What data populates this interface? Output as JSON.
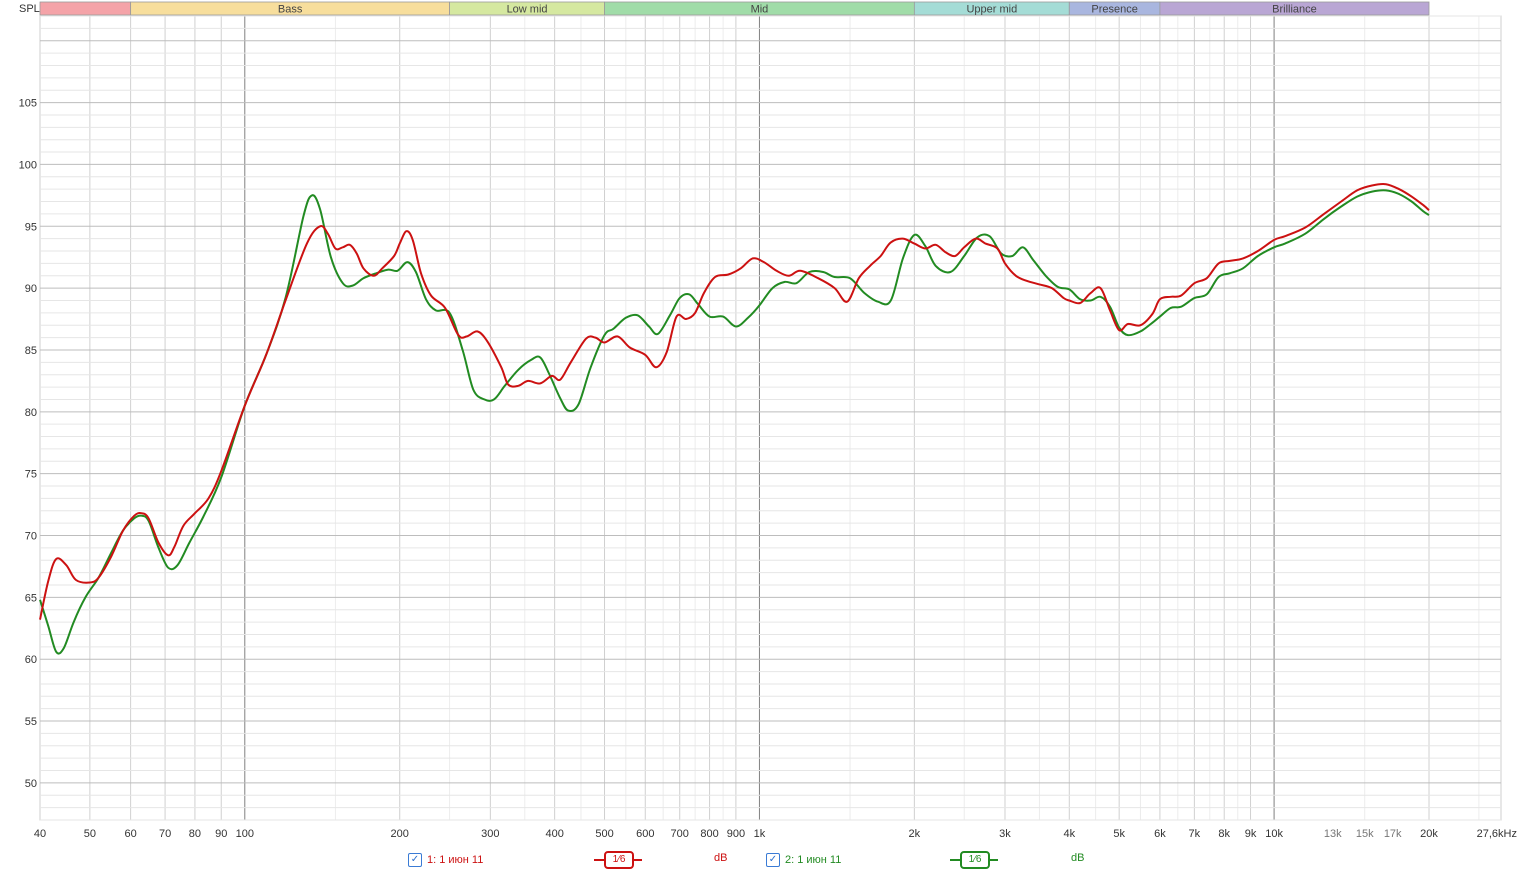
{
  "y_axis_label": "SPL",
  "bands": [
    {
      "label": "",
      "from": 40,
      "to": 60,
      "color": "#f4a3a8"
    },
    {
      "label": "Bass",
      "from": 60,
      "to": 250,
      "color": "#f7de9c"
    },
    {
      "label": "Low mid",
      "from": 250,
      "to": 500,
      "color": "#d5e8a0"
    },
    {
      "label": "Mid",
      "from": 500,
      "to": 2000,
      "color": "#a0dca8"
    },
    {
      "label": "Upper mid",
      "from": 2000,
      "to": 4000,
      "color": "#a4dcd6"
    },
    {
      "label": "Presence",
      "from": 4000,
      "to": 6000,
      "color": "#a9b6df"
    },
    {
      "label": "Brilliance",
      "from": 6000,
      "to": 20000,
      "color": "#b9a6d4"
    }
  ],
  "legend": [
    {
      "checked": "✓",
      "label": "1: 1 июн 11",
      "smoothing": "1⁄6",
      "unit": "dB",
      "color": "#cc1111"
    },
    {
      "checked": "✓",
      "label": "2: 1 июн 11",
      "smoothing": "1⁄6",
      "unit": "dB",
      "color": "#228b22"
    }
  ],
  "chart_data": {
    "type": "line",
    "xscale": "log",
    "xlim": [
      40,
      27600
    ],
    "ylim": [
      47,
      112
    ],
    "grid": true,
    "x_ticks": [
      {
        "value": 40,
        "label": "40"
      },
      {
        "value": 50,
        "label": "50"
      },
      {
        "value": 60,
        "label": "60"
      },
      {
        "value": 70,
        "label": "70"
      },
      {
        "value": 80,
        "label": "80"
      },
      {
        "value": 90,
        "label": "90"
      },
      {
        "value": 100,
        "label": "100"
      },
      {
        "value": 200,
        "label": "200"
      },
      {
        "value": 300,
        "label": "300"
      },
      {
        "value": 400,
        "label": "400"
      },
      {
        "value": 500,
        "label": "500"
      },
      {
        "value": 600,
        "label": "600"
      },
      {
        "value": 700,
        "label": "700"
      },
      {
        "value": 800,
        "label": "800"
      },
      {
        "value": 900,
        "label": "900"
      },
      {
        "value": 1000,
        "label": "1k"
      },
      {
        "value": 2000,
        "label": "2k"
      },
      {
        "value": 3000,
        "label": "3k"
      },
      {
        "value": 4000,
        "label": "4k"
      },
      {
        "value": 5000,
        "label": "5k"
      },
      {
        "value": 6000,
        "label": "6k"
      },
      {
        "value": 7000,
        "label": "7k"
      },
      {
        "value": 8000,
        "label": "8k"
      },
      {
        "value": 9000,
        "label": "9k"
      },
      {
        "value": 10000,
        "label": "10k"
      },
      {
        "value": 13000,
        "label": "13k",
        "light": true
      },
      {
        "value": 15000,
        "label": "15k",
        "light": true
      },
      {
        "value": 17000,
        "label": "17k",
        "light": true
      },
      {
        "value": 20000,
        "label": "20k"
      },
      {
        "value": 27600,
        "label": "27,6kHz"
      }
    ],
    "y_ticks": [
      50,
      55,
      60,
      65,
      70,
      75,
      80,
      85,
      90,
      95,
      100,
      105
    ],
    "series": [
      {
        "name": "1: 1 июн 11",
        "color": "#cc1111",
        "points": [
          [
            40,
            63.2
          ],
          [
            41.5,
            66.3
          ],
          [
            43,
            68.1
          ],
          [
            45,
            67.6
          ],
          [
            47,
            66.4
          ],
          [
            50,
            66.2
          ],
          [
            52,
            66.6
          ],
          [
            55,
            68.3
          ],
          [
            58,
            70.4
          ],
          [
            61,
            71.6
          ],
          [
            63,
            71.8
          ],
          [
            65,
            71.4
          ],
          [
            68,
            69.4
          ],
          [
            71,
            68.4
          ],
          [
            73,
            69.1
          ],
          [
            76,
            70.8
          ],
          [
            80,
            71.8
          ],
          [
            85,
            73.0
          ],
          [
            90,
            75.2
          ],
          [
            100,
            80.5
          ],
          [
            110,
            84.6
          ],
          [
            120,
            89.0
          ],
          [
            132,
            93.6
          ],
          [
            140,
            95.0
          ],
          [
            145,
            94.4
          ],
          [
            150,
            93.2
          ],
          [
            155,
            93.3
          ],
          [
            160,
            93.5
          ],
          [
            165,
            92.8
          ],
          [
            170,
            91.6
          ],
          [
            178,
            91.0
          ],
          [
            185,
            91.6
          ],
          [
            195,
            92.6
          ],
          [
            200,
            93.6
          ],
          [
            206,
            94.6
          ],
          [
            212,
            93.9
          ],
          [
            220,
            91.2
          ],
          [
            230,
            89.4
          ],
          [
            245,
            88.4
          ],
          [
            260,
            86.2
          ],
          [
            270,
            86.1
          ],
          [
            283,
            86.5
          ],
          [
            296,
            85.7
          ],
          [
            315,
            83.6
          ],
          [
            325,
            82.2
          ],
          [
            340,
            82.1
          ],
          [
            355,
            82.5
          ],
          [
            375,
            82.3
          ],
          [
            395,
            82.9
          ],
          [
            410,
            82.6
          ],
          [
            430,
            84.0
          ],
          [
            460,
            85.9
          ],
          [
            480,
            86.0
          ],
          [
            500,
            85.6
          ],
          [
            530,
            86.1
          ],
          [
            560,
            85.2
          ],
          [
            600,
            84.6
          ],
          [
            630,
            83.6
          ],
          [
            660,
            84.8
          ],
          [
            690,
            87.7
          ],
          [
            720,
            87.5
          ],
          [
            750,
            88.0
          ],
          [
            780,
            89.6
          ],
          [
            820,
            90.9
          ],
          [
            870,
            91.1
          ],
          [
            920,
            91.6
          ],
          [
            970,
            92.4
          ],
          [
            1020,
            92.1
          ],
          [
            1080,
            91.4
          ],
          [
            1140,
            91.0
          ],
          [
            1200,
            91.4
          ],
          [
            1300,
            90.8
          ],
          [
            1400,
            90.0
          ],
          [
            1480,
            88.9
          ],
          [
            1560,
            90.8
          ],
          [
            1640,
            91.8
          ],
          [
            1720,
            92.6
          ],
          [
            1800,
            93.7
          ],
          [
            1900,
            94.0
          ],
          [
            2000,
            93.6
          ],
          [
            2100,
            93.2
          ],
          [
            2200,
            93.5
          ],
          [
            2300,
            92.9
          ],
          [
            2400,
            92.6
          ],
          [
            2500,
            93.3
          ],
          [
            2630,
            94.0
          ],
          [
            2750,
            93.6
          ],
          [
            2900,
            93.2
          ],
          [
            3000,
            92.0
          ],
          [
            3150,
            91.0
          ],
          [
            3300,
            90.6
          ],
          [
            3500,
            90.3
          ],
          [
            3700,
            90.0
          ],
          [
            3900,
            89.2
          ],
          [
            4000,
            89.0
          ],
          [
            4200,
            88.8
          ],
          [
            4400,
            89.6
          ],
          [
            4600,
            90.0
          ],
          [
            4800,
            88.2
          ],
          [
            5000,
            86.6
          ],
          [
            5200,
            87.1
          ],
          [
            5500,
            87.0
          ],
          [
            5800,
            87.9
          ],
          [
            6000,
            89.1
          ],
          [
            6300,
            89.3
          ],
          [
            6600,
            89.4
          ],
          [
            7000,
            90.4
          ],
          [
            7400,
            90.8
          ],
          [
            7800,
            92.0
          ],
          [
            8200,
            92.2
          ],
          [
            8700,
            92.4
          ],
          [
            9300,
            93.0
          ],
          [
            10000,
            93.9
          ],
          [
            10500,
            94.2
          ],
          [
            11500,
            94.9
          ],
          [
            12500,
            96.0
          ],
          [
            13500,
            97.0
          ],
          [
            14500,
            97.9
          ],
          [
            15500,
            98.3
          ],
          [
            16500,
            98.4
          ],
          [
            17500,
            98.0
          ],
          [
            18500,
            97.4
          ],
          [
            19500,
            96.7
          ],
          [
            20000,
            96.3
          ]
        ]
      },
      {
        "name": "2: 1 июн 11",
        "color": "#228b22",
        "points": [
          [
            40,
            64.8
          ],
          [
            41.5,
            62.7
          ],
          [
            43,
            60.6
          ],
          [
            44.5,
            60.9
          ],
          [
            46.5,
            63.0
          ],
          [
            49,
            65.0
          ],
          [
            52,
            66.6
          ],
          [
            55,
            68.6
          ],
          [
            58,
            70.4
          ],
          [
            61,
            71.4
          ],
          [
            63,
            71.6
          ],
          [
            65,
            71.2
          ],
          [
            68,
            69.0
          ],
          [
            71,
            67.4
          ],
          [
            74,
            67.6
          ],
          [
            78,
            69.4
          ],
          [
            83,
            71.5
          ],
          [
            90,
            74.7
          ],
          [
            100,
            80.5
          ],
          [
            110,
            84.6
          ],
          [
            120,
            89.2
          ],
          [
            130,
            95.8
          ],
          [
            135,
            97.5
          ],
          [
            140,
            96.4
          ],
          [
            147,
            92.5
          ],
          [
            155,
            90.4
          ],
          [
            162,
            90.2
          ],
          [
            170,
            90.8
          ],
          [
            180,
            91.2
          ],
          [
            190,
            91.5
          ],
          [
            198,
            91.4
          ],
          [
            207,
            92.1
          ],
          [
            215,
            91.3
          ],
          [
            225,
            89.1
          ],
          [
            235,
            88.2
          ],
          [
            250,
            88.0
          ],
          [
            265,
            85.0
          ],
          [
            278,
            81.8
          ],
          [
            292,
            81.0
          ],
          [
            305,
            81.0
          ],
          [
            320,
            82.1
          ],
          [
            340,
            83.4
          ],
          [
            360,
            84.2
          ],
          [
            375,
            84.4
          ],
          [
            390,
            83.1
          ],
          [
            410,
            81.1
          ],
          [
            425,
            80.1
          ],
          [
            445,
            80.6
          ],
          [
            470,
            83.6
          ],
          [
            500,
            86.2
          ],
          [
            520,
            86.7
          ],
          [
            550,
            87.6
          ],
          [
            580,
            87.8
          ],
          [
            610,
            86.9
          ],
          [
            635,
            86.3
          ],
          [
            670,
            87.8
          ],
          [
            700,
            89.2
          ],
          [
            730,
            89.5
          ],
          [
            760,
            88.7
          ],
          [
            800,
            87.7
          ],
          [
            850,
            87.7
          ],
          [
            900,
            86.9
          ],
          [
            950,
            87.6
          ],
          [
            1000,
            88.6
          ],
          [
            1060,
            90.0
          ],
          [
            1120,
            90.5
          ],
          [
            1180,
            90.4
          ],
          [
            1250,
            91.3
          ],
          [
            1330,
            91.3
          ],
          [
            1400,
            90.9
          ],
          [
            1500,
            90.8
          ],
          [
            1600,
            89.6
          ],
          [
            1700,
            88.9
          ],
          [
            1800,
            89.0
          ],
          [
            1900,
            92.4
          ],
          [
            2000,
            94.3
          ],
          [
            2100,
            93.4
          ],
          [
            2200,
            91.8
          ],
          [
            2350,
            91.3
          ],
          [
            2500,
            92.6
          ],
          [
            2650,
            94.1
          ],
          [
            2800,
            94.2
          ],
          [
            2950,
            92.8
          ],
          [
            3100,
            92.6
          ],
          [
            3250,
            93.3
          ],
          [
            3400,
            92.3
          ],
          [
            3600,
            91.0
          ],
          [
            3800,
            90.1
          ],
          [
            4000,
            89.9
          ],
          [
            4200,
            89.1
          ],
          [
            4400,
            89.0
          ],
          [
            4600,
            89.3
          ],
          [
            4800,
            88.5
          ],
          [
            5000,
            86.8
          ],
          [
            5200,
            86.2
          ],
          [
            5500,
            86.5
          ],
          [
            5800,
            87.2
          ],
          [
            6000,
            87.7
          ],
          [
            6300,
            88.4
          ],
          [
            6600,
            88.5
          ],
          [
            7000,
            89.2
          ],
          [
            7400,
            89.5
          ],
          [
            7800,
            90.9
          ],
          [
            8200,
            91.2
          ],
          [
            8700,
            91.6
          ],
          [
            9300,
            92.6
          ],
          [
            10000,
            93.3
          ],
          [
            10500,
            93.6
          ],
          [
            11500,
            94.4
          ],
          [
            12500,
            95.6
          ],
          [
            13500,
            96.6
          ],
          [
            14500,
            97.4
          ],
          [
            15500,
            97.8
          ],
          [
            16500,
            97.9
          ],
          [
            17500,
            97.6
          ],
          [
            18500,
            97.0
          ],
          [
            19500,
            96.2
          ],
          [
            20000,
            95.9
          ]
        ]
      }
    ]
  }
}
